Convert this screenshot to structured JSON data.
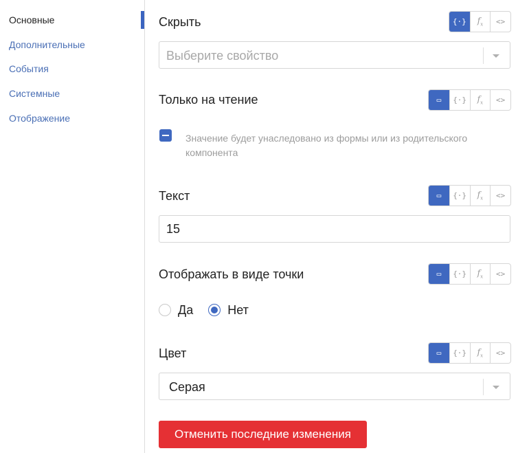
{
  "sidebar": {
    "items": [
      {
        "label": "Основные",
        "active": true
      },
      {
        "label": "Дополнительные",
        "active": false
      },
      {
        "label": "События",
        "active": false
      },
      {
        "label": "Системные",
        "active": false
      },
      {
        "label": "Отображение",
        "active": false
      }
    ]
  },
  "fields": {
    "hide": {
      "label": "Скрыть",
      "placeholder": "Выберите свойство",
      "modes": [
        "binding",
        "formula",
        "code"
      ],
      "active_mode": "binding"
    },
    "readonly": {
      "label": "Только на чтение",
      "hint": "Значение будет унаследовано из формы или из родительского компонента",
      "modes": [
        "static",
        "binding",
        "formula",
        "code"
      ],
      "active_mode": "static",
      "checkbox_state": "indeterminate"
    },
    "text": {
      "label": "Текст",
      "value": "15",
      "modes": [
        "static",
        "binding",
        "formula",
        "code"
      ],
      "active_mode": "static"
    },
    "dot": {
      "label": "Отображать в виде точки",
      "options": [
        {
          "label": "Да",
          "checked": false
        },
        {
          "label": "Нет",
          "checked": true
        }
      ],
      "modes": [
        "static",
        "binding",
        "formula",
        "code"
      ],
      "active_mode": "static"
    },
    "color": {
      "label": "Цвет",
      "value": "Серая",
      "modes": [
        "static",
        "binding",
        "formula",
        "code"
      ],
      "active_mode": "static"
    }
  },
  "actions": {
    "revert_label": "Отменить последние изменения"
  },
  "colors": {
    "accent": "#3f68c0",
    "danger": "#e53034",
    "link": "#4a6fb5"
  }
}
